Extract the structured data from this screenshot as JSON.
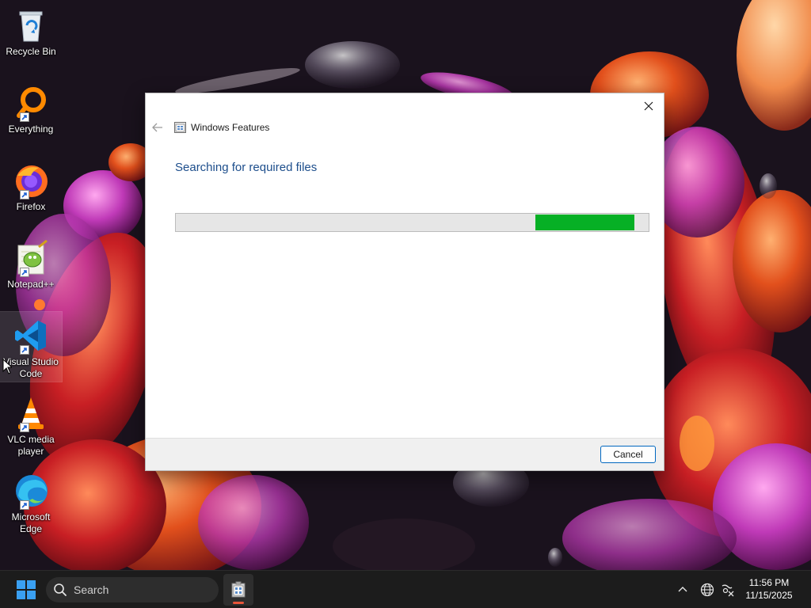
{
  "desktop": {
    "icons": [
      {
        "label": "Recycle Bin",
        "icon": "recycle-bin-icon",
        "shortcut": false
      },
      {
        "label": "Everything",
        "icon": "everything-search-icon",
        "shortcut": true
      },
      {
        "label": "Firefox",
        "icon": "firefox-icon",
        "shortcut": true
      },
      {
        "label": "Notepad++",
        "icon": "notepad-plus-plus-icon",
        "shortcut": true
      },
      {
        "label": "Visual Studio Code",
        "icon": "vscode-icon",
        "shortcut": true,
        "selected": true
      },
      {
        "label": "VLC media player",
        "icon": "vlc-icon",
        "shortcut": true
      },
      {
        "label": "Microsoft Edge",
        "icon": "edge-icon",
        "shortcut": true
      }
    ]
  },
  "dialog": {
    "window_title": "Windows Features",
    "heading": "Searching for required files",
    "progress": {
      "segment_start_fraction": 0.76,
      "segment_end_fraction": 0.97,
      "fill_color": "#06b025",
      "mode": "indeterminate"
    },
    "cancel_label": "Cancel",
    "heading_color": "#1d4e8c"
  },
  "taskbar": {
    "search_placeholder": "Search",
    "pinned_app_icon": "windows-features-icon",
    "clock_time": "11:56 PM",
    "clock_date": "11/15/2025",
    "tray_icons": [
      "chevron-up-icon",
      "globe-icon",
      "network-icon"
    ]
  }
}
